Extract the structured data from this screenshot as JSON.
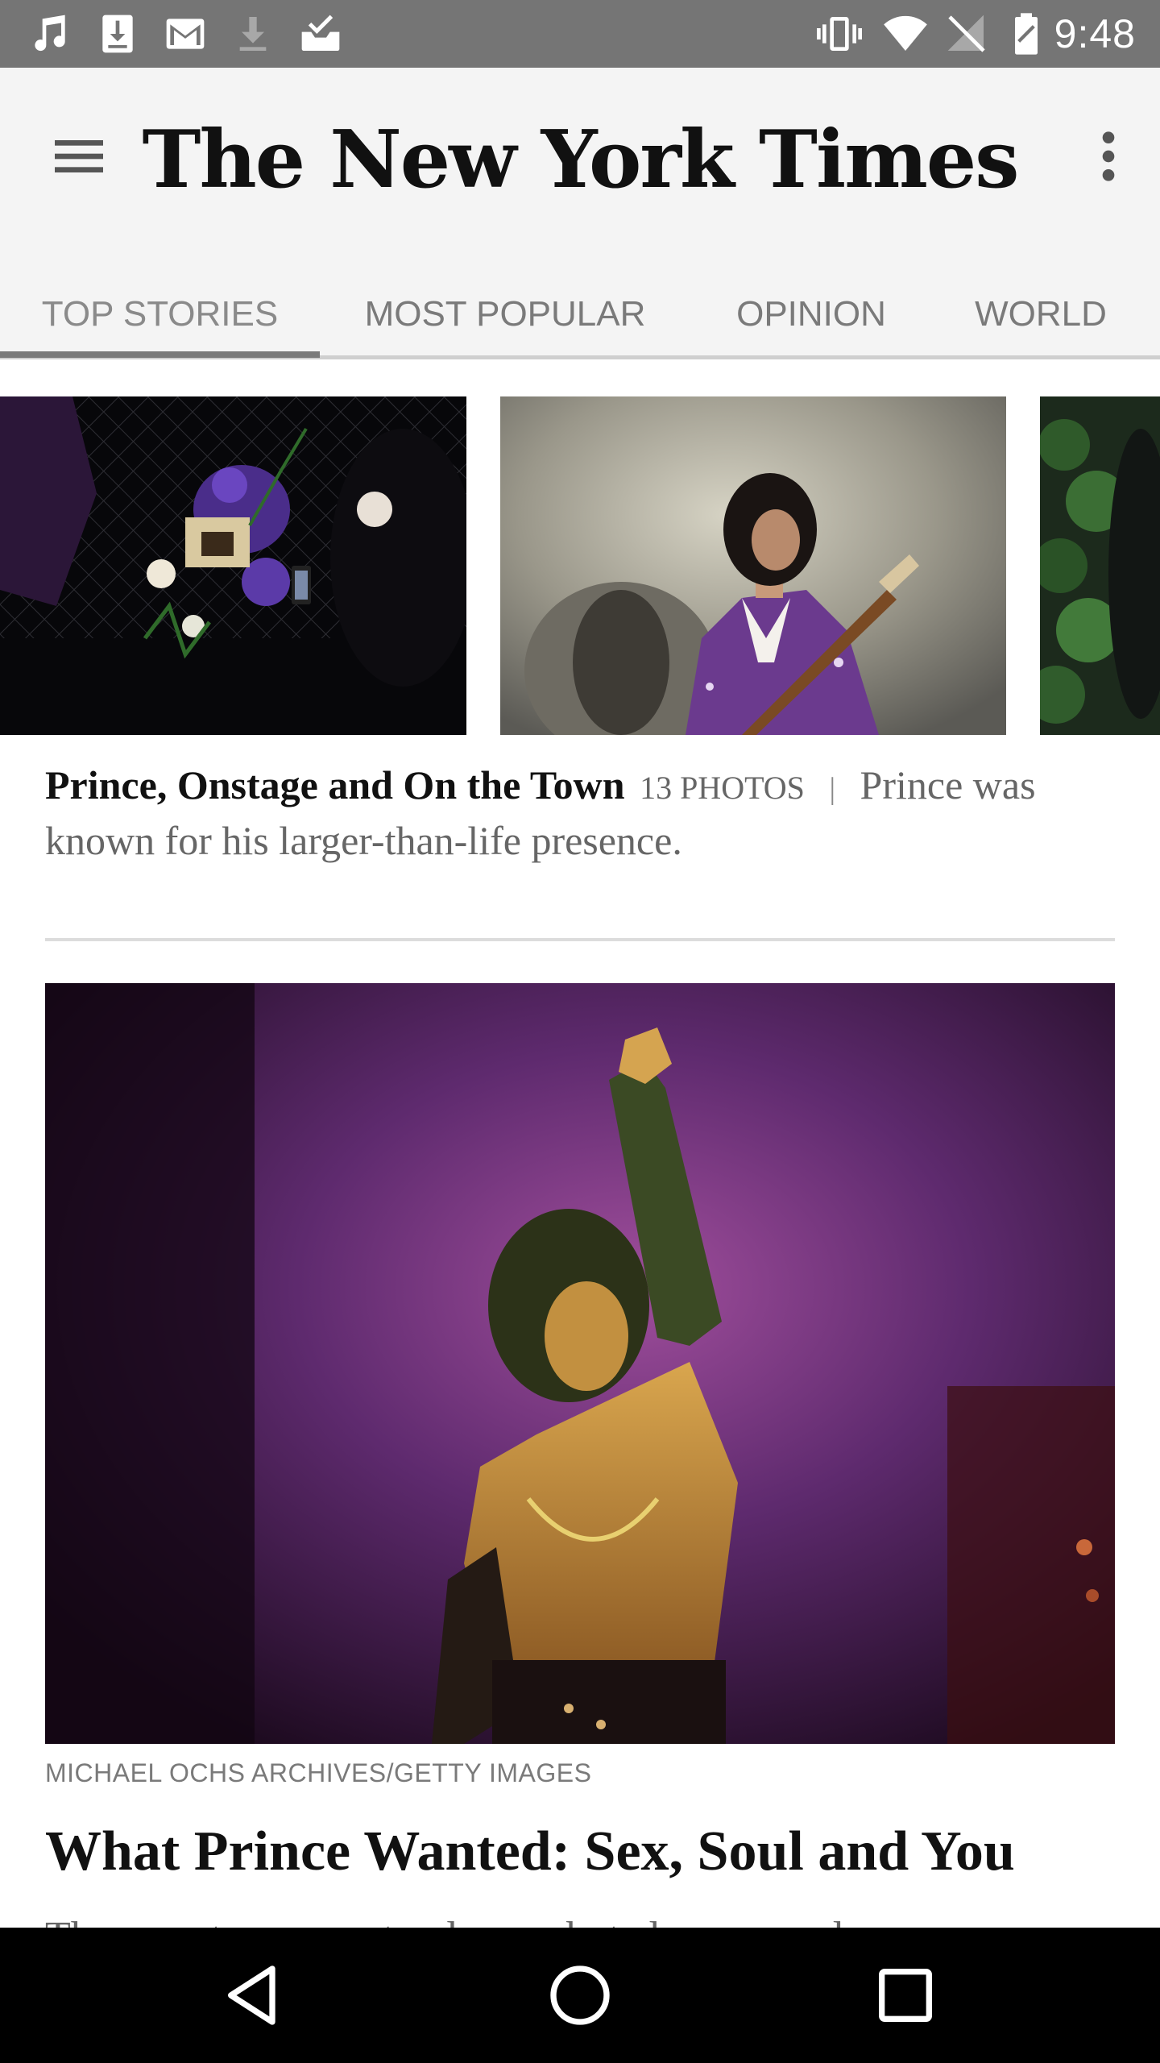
{
  "status_bar": {
    "time": "9:48",
    "left_icons": [
      "music-note-icon",
      "download-box-icon",
      "gmail-icon",
      "download-arrow-icon",
      "inbox-check-icon"
    ],
    "right_icons": [
      "vibrate-icon",
      "wifi-icon",
      "no-signal-icon",
      "battery-icon"
    ]
  },
  "app_bar": {
    "logo": "The New York Times",
    "menu_icon": "hamburger-menu-icon",
    "overflow_icon": "more-vertical-icon"
  },
  "tabs": [
    {
      "label": "TOP STORIES",
      "active": true
    },
    {
      "label": "MOST POPULAR",
      "active": false
    },
    {
      "label": "OPINION",
      "active": false
    },
    {
      "label": "WORLD",
      "active": false
    }
  ],
  "gallery": {
    "headline": "Prince, Onstage and On the Town",
    "count": "13 PHOTOS",
    "separator": "|",
    "summary": "Prince was known for his larger-than-life presence."
  },
  "story": {
    "credit": "MICHAEL OCHS ARCHIVES/GETTY IMAGES",
    "headline": "What Prince Wanted: Sex, Soul and You",
    "summary": "The pop star was not only sex, but also a sexual"
  },
  "nav_bar": {
    "icons": [
      "back-triangle-icon",
      "home-circle-icon",
      "recents-square-icon"
    ]
  },
  "colors": {
    "status_bar": "#757575",
    "app_bar": "#f4f4f4",
    "nav_bar": "#000000",
    "headline": "#111111",
    "secondary_text": "#666666"
  }
}
